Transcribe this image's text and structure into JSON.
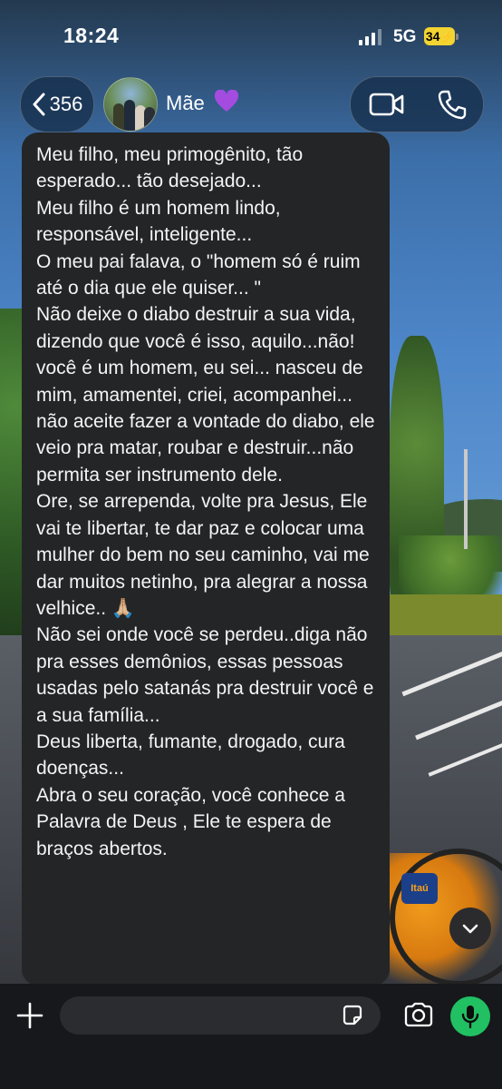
{
  "status_bar": {
    "time": "18:24",
    "network": "5G",
    "battery": "34"
  },
  "header": {
    "back_count": "356",
    "contact_name": "Mãe",
    "contact_emoji": "💜",
    "icons": [
      "chevron-left-icon",
      "video-camera-icon",
      "phone-icon"
    ]
  },
  "message": {
    "text": "Meu filho,  meu primogênito,  tão esperado... tão desejado...\nMeu filho é  um homem lindo, responsável, inteligente...\nO meu pai falava,  o \"homem só é ruim até o dia que ele quiser... \"\nNão deixe o diabo destruir a sua vida, dizendo que você é isso, aquilo...não! você é um homem, eu sei... nasceu de mim, amamentei, criei,  acompanhei... não aceite fazer a vontade do diabo,  ele veio pra matar,  roubar e destruir...não permita ser instrumento dele.\nOre, se arrependa,  volte pra Jesus, Ele vai te libertar,  te dar paz e colocar uma mulher do bem no seu caminho, vai me dar muitos netinho, pra alegrar a nossa velhice.. 🙏🏼\nNão sei onde você se perdeu..diga não pra esses demônios, essas pessoas usadas pelo satanás pra destruir você e a sua família...\nDeus liberta, fumante, drogado, cura doenças...\nAbra o seu coração,  você conhece a Palavra de Deus , Ele te espera de braços abertos."
  },
  "wallpaper": {
    "bike_logo": "Itaú"
  },
  "input_bar": {
    "placeholder": "",
    "icons": [
      "plus-icon",
      "sticker-icon",
      "camera-icon",
      "microphone-icon"
    ]
  },
  "colors": {
    "bubble": "#242526",
    "accent_green": "#21c063",
    "header_pill": "#142c48",
    "battery": "#f3d431"
  }
}
